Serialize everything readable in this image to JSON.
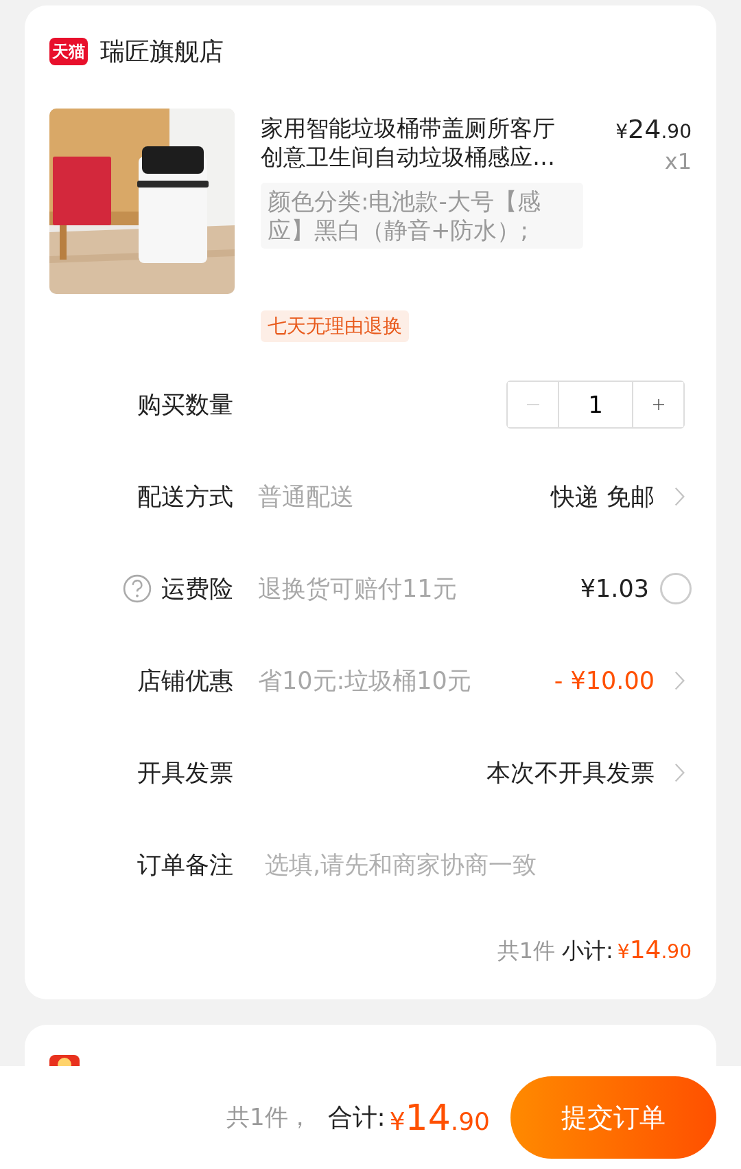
{
  "store": {
    "logo_text": "天猫",
    "name": "瑞匠旗舰店"
  },
  "product": {
    "title": "家用智能垃圾桶带盖厕所客厅创意卫生间自动垃圾桶感应…",
    "price": {
      "symbol": "¥",
      "integer": "24",
      "decimal": ".90"
    },
    "quantity": "x1",
    "spec": "颜色分类:电池款-大号【感应】黑白（静音+防水）;",
    "tags": [
      "七天无理由退换"
    ]
  },
  "rows": [
    {
      "kind": "stepper",
      "label": "购买数量",
      "value": "1",
      "minus_disabled": true
    },
    {
      "kind": "link",
      "label": "配送方式",
      "value": "普通配送",
      "detail": "快递 免邮",
      "highlight": false
    },
    {
      "kind": "radio",
      "label": "运费险",
      "help": true,
      "value": "退换货可赔付11元",
      "detail": "¥1.03",
      "selected": false
    },
    {
      "kind": "link",
      "label": "店铺优惠",
      "value": "省10元:垃圾桶10元",
      "detail": "- ¥10.00",
      "highlight": true
    },
    {
      "kind": "link",
      "label": "开具发票",
      "detail": "本次不开具发票",
      "highlight": false
    },
    {
      "kind": "input",
      "label": "订单备注",
      "placeholder": "选填,请先和商家协商一致"
    }
  ],
  "subtotal": {
    "count": "共1件",
    "label": "小计:",
    "symbol": "¥",
    "integer": "14",
    "decimal": ".90"
  },
  "footer": {
    "count": "共1件，",
    "label": "合计:",
    "symbol": "¥",
    "integer": "14",
    "decimal": ".90",
    "button": "提交订单"
  }
}
